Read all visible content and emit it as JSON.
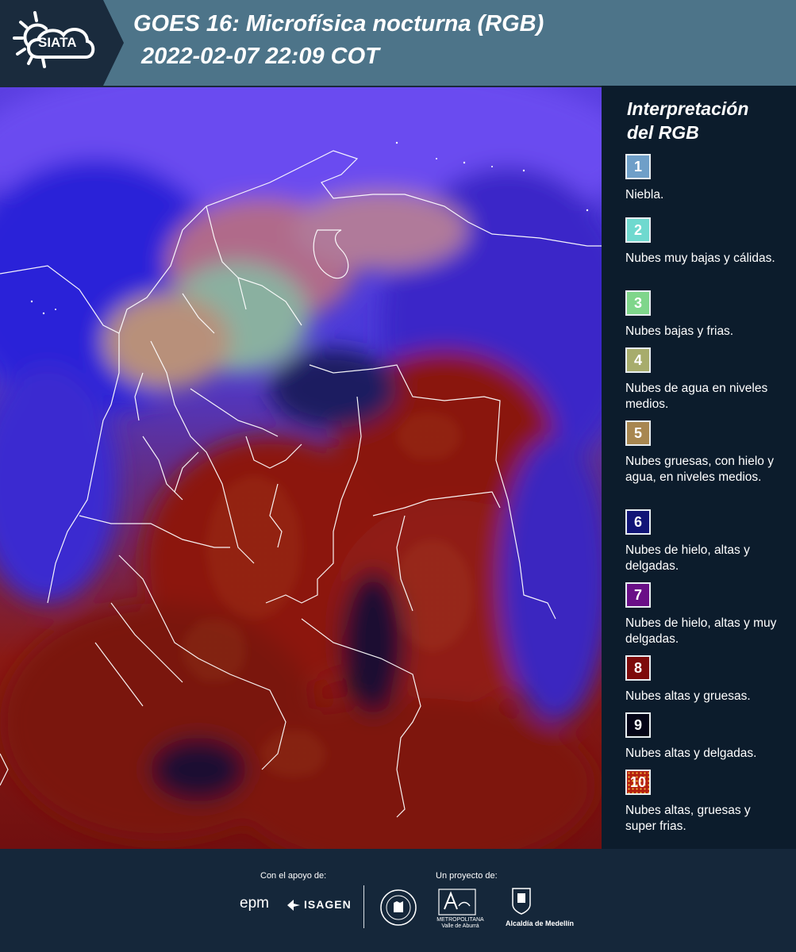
{
  "header": {
    "logo_text": "SIATA",
    "title_line1": "GOES 16: Microfísica nocturna (RGB)",
    "title_line2": "2022-02-07 22:09 COT"
  },
  "legend": {
    "title_line1": "Interpretación",
    "title_line2": "del RGB",
    "items": [
      {
        "num": "1",
        "text": "Niebla.",
        "color": "#6f9fc8"
      },
      {
        "num": "2",
        "text": "Nubes muy bajas y cálidas.",
        "color": "#6fd9cf"
      },
      {
        "num": "3",
        "text": "Nubes bajas y frias.",
        "color": "#7fd68b"
      },
      {
        "num": "4",
        "text": "Nubes de agua en niveles medios.",
        "color": "#a7ac6c"
      },
      {
        "num": "5",
        "text": "Nubes gruesas, con hielo y agua, en niveles medios.",
        "color": "#a88751"
      },
      {
        "num": "6",
        "text": "Nubes de hielo, altas y delgadas.",
        "color": "#121577"
      },
      {
        "num": "7",
        "text": "Nubes de hielo, altas y muy delgadas.",
        "color": "#6a0f87"
      },
      {
        "num": "8",
        "text": "Nubes altas y gruesas.",
        "color": "#7e0b0b"
      },
      {
        "num": "9",
        "text": "Nubes altas y delgadas.",
        "color": "#050518"
      },
      {
        "num": "10",
        "text": "Nubes altas, gruesas y super frias.",
        "color": "#b4200f"
      }
    ]
  },
  "footer": {
    "support_label": "Con el apoyo de:",
    "project_label": "Un proyecto de:",
    "epm": "epm",
    "isagen": "ISAGEN",
    "area_line1": "METROPOLITANA",
    "area_line2": "Valle de Aburrá",
    "alcaldia": "Alcaldía de Medellín"
  }
}
